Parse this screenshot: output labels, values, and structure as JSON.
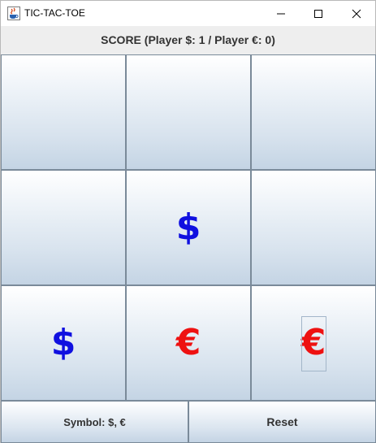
{
  "window": {
    "title": "TIC-TAC-TOE",
    "icons": {
      "app": "java-cup-icon",
      "minimize": "minimize-icon",
      "maximize": "maximize-icon",
      "close": "close-icon"
    }
  },
  "score": {
    "text": "SCORE (Player $:  1 /  Player €:  0)",
    "player1_symbol": "$",
    "player1_score": 1,
    "player2_symbol": "€",
    "player2_score": 0
  },
  "board": {
    "cells": [
      {
        "mark": "",
        "color": ""
      },
      {
        "mark": "",
        "color": ""
      },
      {
        "mark": "",
        "color": ""
      },
      {
        "mark": "",
        "color": ""
      },
      {
        "mark": "$",
        "color": "#1010e0"
      },
      {
        "mark": "",
        "color": ""
      },
      {
        "mark": "$",
        "color": "#1010e0"
      },
      {
        "mark": "€",
        "color": "#ee1111"
      },
      {
        "mark": "€",
        "color": "#ee1111"
      }
    ],
    "focused_cell": 8
  },
  "controls": {
    "symbol_label": "Symbol: $, €",
    "reset_label": "Reset"
  },
  "colors": {
    "dollar": "#1010e0",
    "euro": "#ee1111",
    "cell_border": "#7a8a99"
  }
}
